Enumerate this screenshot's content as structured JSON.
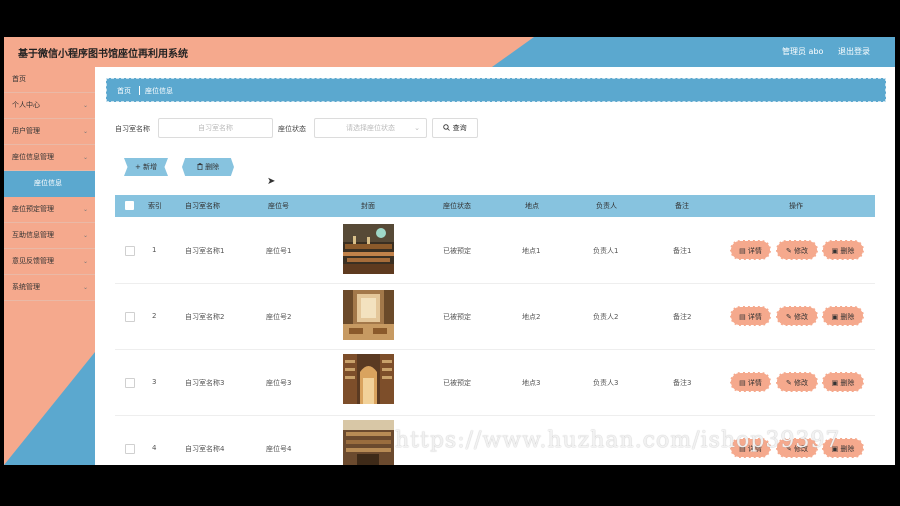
{
  "header": {
    "app_title": "基于微信小程序图书馆座位再利用系统",
    "user_label": "管理员 abo",
    "logout_label": "退出登录"
  },
  "sidebar": {
    "items": [
      {
        "label": "首页",
        "has_chevron": false
      },
      {
        "label": "个人中心",
        "has_chevron": true
      },
      {
        "label": "用户管理",
        "has_chevron": true
      },
      {
        "label": "座位信息管理",
        "has_chevron": true
      },
      {
        "label": "座位信息",
        "has_chevron": false,
        "active": true
      },
      {
        "label": "座位预定管理",
        "has_chevron": true
      },
      {
        "label": "互助信息管理",
        "has_chevron": true
      },
      {
        "label": "意见反馈管理",
        "has_chevron": true
      },
      {
        "label": "系统管理",
        "has_chevron": true
      }
    ]
  },
  "breadcrumb": {
    "home": "首页",
    "current": "座位信息"
  },
  "filters": {
    "room_label": "自习室名称",
    "room_placeholder": "自习室名称",
    "status_label": "座位状态",
    "status_placeholder": "请选择座位状态",
    "search_label": "查询"
  },
  "actions": {
    "add_label": "新增",
    "delete_label": "删除"
  },
  "table": {
    "headers": [
      "索引",
      "自习室名称",
      "座位号",
      "封面",
      "座位状态",
      "地点",
      "负责人",
      "备注",
      "操作"
    ],
    "row_actions": {
      "detail": "详情",
      "edit": "修改",
      "delete": "删除"
    },
    "rows": [
      {
        "index": "1",
        "room": "自习室名称1",
        "seat": "座位号1",
        "status": "已被预定",
        "location": "地点1",
        "manager": "负责人1",
        "note": "备注1"
      },
      {
        "index": "2",
        "room": "自习室名称2",
        "seat": "座位号2",
        "status": "已被预定",
        "location": "地点2",
        "manager": "负责人2",
        "note": "备注2"
      },
      {
        "index": "3",
        "room": "自习室名称3",
        "seat": "座位号3",
        "status": "已被预定",
        "location": "地点3",
        "manager": "负责人3",
        "note": "备注3"
      },
      {
        "index": "4",
        "room": "自习室名称4",
        "seat": "座位号4",
        "status": "",
        "location": "",
        "manager": "",
        "note": ""
      }
    ]
  },
  "icons": {
    "search": "search-icon",
    "add": "plus-icon",
    "delete": "trash-icon",
    "detail": "document-icon",
    "edit": "pencil-icon",
    "chevron": "chevron-down-icon"
  },
  "colors": {
    "salmon": "#f5a98d",
    "blue": "#5ba8cf",
    "light_blue": "#87c3df"
  },
  "watermark": "https://www.huzhan.com/ishop39397"
}
